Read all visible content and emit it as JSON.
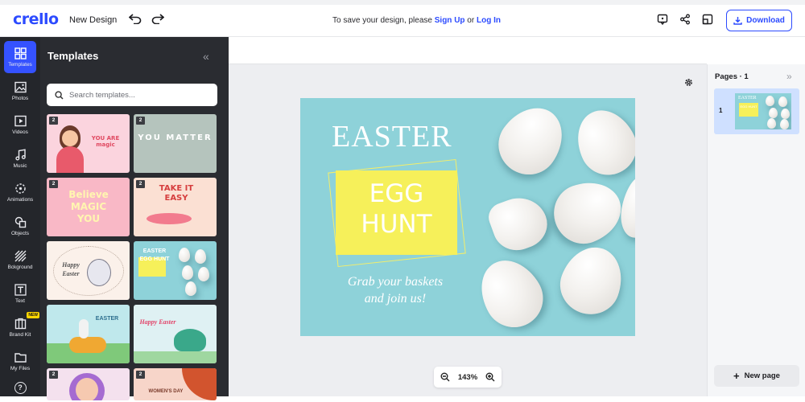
{
  "header": {
    "logo": "crello",
    "design_name": "New Design",
    "save_prefix": "To save your design, please ",
    "sign_up": "Sign Up",
    "or": " or ",
    "log_in": "Log In",
    "download_label": "Download"
  },
  "rail": {
    "items": [
      {
        "label": "Templates",
        "icon": "templates-icon"
      },
      {
        "label": "Photos",
        "icon": "photos-icon"
      },
      {
        "label": "Videos",
        "icon": "videos-icon"
      },
      {
        "label": "Music",
        "icon": "music-icon"
      },
      {
        "label": "Animations",
        "icon": "animations-icon"
      },
      {
        "label": "Objects",
        "icon": "objects-icon"
      },
      {
        "label": "Bckground",
        "icon": "background-icon"
      },
      {
        "label": "Text",
        "icon": "text-icon"
      },
      {
        "label": "Brand Kit",
        "icon": "brand-kit-icon"
      },
      {
        "label": "My Files",
        "icon": "my-files-icon"
      }
    ],
    "new_badge": "NEW",
    "help_glyph": "?"
  },
  "panel": {
    "title": "Templates",
    "collapse_glyph": "«",
    "search_placeholder": "Search templates...",
    "tiles": [
      {
        "badge": "2",
        "text": "YOU ARE magic",
        "bg": "#fbd4de"
      },
      {
        "badge": "2",
        "text": "YOU MATTER",
        "bg": "#b5c4bd"
      },
      {
        "badge": "2",
        "text": "Believe MAGIC YOU",
        "bg": "#f9b8c6"
      },
      {
        "badge": "2",
        "text": "TAKE IT EASY",
        "bg": "#fbe0d3"
      },
      {
        "badge": "",
        "text": "Happy Easter",
        "bg": "#fbf1ea"
      },
      {
        "badge": "",
        "text": "EASTER EGG HUNT",
        "bg": "#8ed2d9"
      },
      {
        "badge": "",
        "text": "EASTER",
        "bg": "#bfe8ec"
      },
      {
        "badge": "",
        "text": "Happy Easter",
        "bg": "#dff1f3"
      },
      {
        "badge": "2",
        "text": "",
        "bg": "#f4e1ee"
      },
      {
        "badge": "2",
        "text": "WOMEN'S DAY",
        "bg": "#f7d5c9"
      }
    ]
  },
  "canvas": {
    "title": "EASTER",
    "egg_hunt_1": "EGG",
    "egg_hunt_2": "HUNT",
    "tagline_1": "Grab your baskets",
    "tagline_2": "and join us!"
  },
  "zoom": {
    "minus": "−",
    "value": "143%",
    "plus": "+"
  },
  "pages": {
    "title": "Pages · 1",
    "expand_glyph": "»",
    "page_number": "1",
    "thumb_title": "EASTER",
    "thumb_sub": "EGG HUNT",
    "new_page_label": "New page"
  },
  "colors": {
    "accent": "#2c4bff",
    "rail_bg": "#24262b",
    "panel_bg": "#2a2c31",
    "canvas_bg": "#8ed2d9",
    "highlight": "#f6f05a"
  }
}
